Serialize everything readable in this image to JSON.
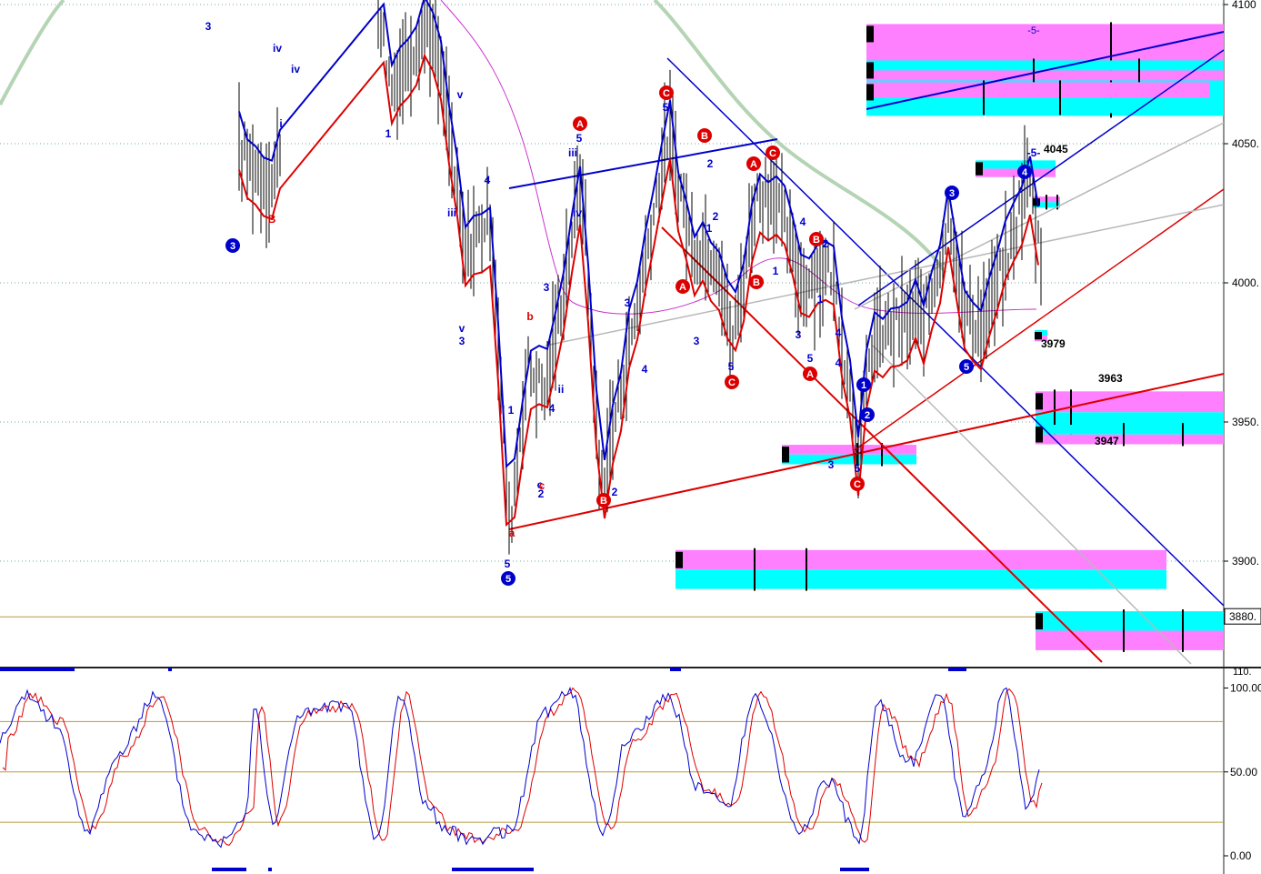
{
  "chart_data": [
    {
      "type": "line",
      "panel": "price",
      "subtype": "ohlc-bars with elliott wave labels",
      "y_ticks": [
        "4100",
        "4050.",
        "4000.",
        "3950.",
        "3900."
      ],
      "y_tick_values": [
        4100,
        4050,
        4000,
        3950,
        3900
      ],
      "last_price_label": "3880.",
      "last_price": 3880,
      "ylim": [
        3862,
        4102
      ],
      "grid": true,
      "price_annotations": [
        {
          "text": "4045",
          "value": 4045
        },
        {
          "text": "3979",
          "value": 3979
        },
        {
          "text": "3963",
          "value": 3963
        },
        {
          "text": "3947",
          "value": 3947
        }
      ],
      "target_zones": [
        {
          "label": "-5-",
          "low": 4060,
          "high": 4093
        },
        {
          "label": "-5-",
          "low": 4038,
          "high": 4044
        },
        {
          "label": "",
          "low": 4027,
          "high": 4031
        },
        {
          "label": "",
          "low": 3979,
          "high": 3983
        },
        {
          "label": "",
          "low": 3946,
          "high": 3961
        },
        {
          "label": "",
          "low": 3942,
          "high": 3949
        },
        {
          "label": "",
          "low": 3890,
          "high": 3904
        },
        {
          "label": "",
          "low": 3868,
          "high": 3882
        }
      ],
      "wave_labels": {
        "blue_text": [
          "3",
          "iv",
          "i",
          "1",
          "iv",
          "iii",
          "4",
          "v",
          "3",
          "1",
          "3",
          "ii",
          "4",
          "2",
          "c",
          "5",
          "5",
          "iii",
          "v",
          "iv",
          "3",
          "4",
          "2",
          "5",
          "2",
          "4",
          "1",
          "3",
          "4",
          "1",
          "2",
          "3",
          "5",
          "3",
          "4",
          "5",
          "2",
          "-5-",
          "1",
          "5"
        ],
        "red_text": [
          "B",
          "b",
          "c",
          "a"
        ],
        "blue_circles": [
          "3",
          "5",
          "1",
          "2",
          "3",
          "4",
          "5"
        ],
        "red_circles": [
          "A",
          "C",
          "B",
          "A",
          "C",
          "A",
          "B",
          "C",
          "B",
          "A",
          "B",
          "C"
        ]
      }
    },
    {
      "type": "line",
      "panel": "stochastic",
      "y_ticks": [
        "100.00",
        "50.00",
        "0.00"
      ],
      "y_tick_values": [
        100,
        50,
        0
      ],
      "top_partial_label": "110.",
      "ylim": [
        -2,
        110
      ],
      "reference_lines": [
        80,
        50,
        20
      ],
      "series": [
        {
          "name": "",
          "color": "#0000cc"
        },
        {
          "name": "",
          "color": "#dd0000"
        }
      ]
    }
  ],
  "colors": {
    "grid": "#6fa8a8",
    "price_blue": "#0000cc",
    "price_red": "#dd0000",
    "magenta_ma": "#cc33cc",
    "green_ma": "#b4d4b4",
    "cyan_zone": "#00ffff",
    "pink_zone": "#ff80ff",
    "olive_line": "#b59a3a"
  }
}
